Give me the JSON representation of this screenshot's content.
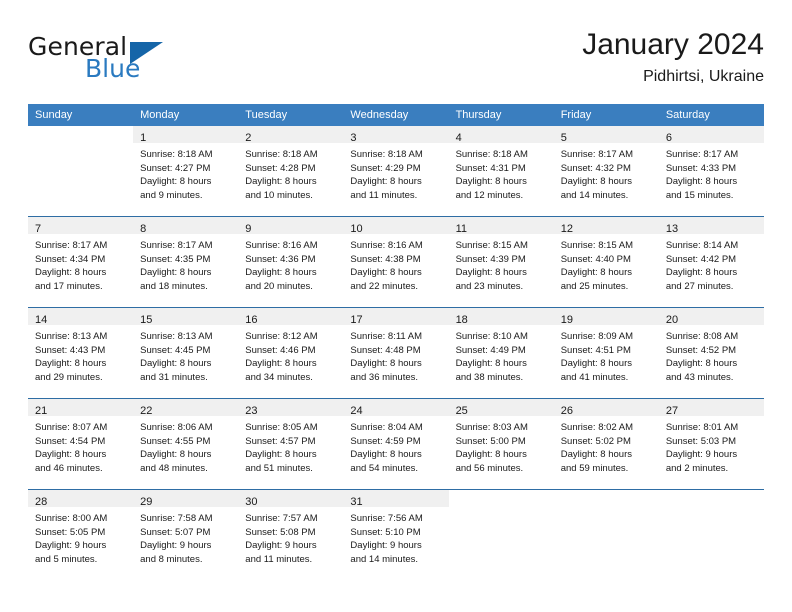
{
  "brand": {
    "word1": "General",
    "word2": "Blue",
    "accent_color": "#1565a8",
    "text_color": "#2a7ac0"
  },
  "header": {
    "title": "January 2024",
    "location": "Pidhirtsi, Ukraine"
  },
  "theme": {
    "header_bg": "#3a7ebf",
    "row_rule": "#2e6da4",
    "daynum_bg": "#f0f0f0"
  },
  "weekdays": [
    "Sunday",
    "Monday",
    "Tuesday",
    "Wednesday",
    "Thursday",
    "Friday",
    "Saturday"
  ],
  "weeks": [
    [
      {
        "day": "",
        "sunrise": "",
        "sunset": "",
        "daylight1": "",
        "daylight2": ""
      },
      {
        "day": "1",
        "sunrise": "Sunrise: 8:18 AM",
        "sunset": "Sunset: 4:27 PM",
        "daylight1": "Daylight: 8 hours",
        "daylight2": "and 9 minutes."
      },
      {
        "day": "2",
        "sunrise": "Sunrise: 8:18 AM",
        "sunset": "Sunset: 4:28 PM",
        "daylight1": "Daylight: 8 hours",
        "daylight2": "and 10 minutes."
      },
      {
        "day": "3",
        "sunrise": "Sunrise: 8:18 AM",
        "sunset": "Sunset: 4:29 PM",
        "daylight1": "Daylight: 8 hours",
        "daylight2": "and 11 minutes."
      },
      {
        "day": "4",
        "sunrise": "Sunrise: 8:18 AM",
        "sunset": "Sunset: 4:31 PM",
        "daylight1": "Daylight: 8 hours",
        "daylight2": "and 12 minutes."
      },
      {
        "day": "5",
        "sunrise": "Sunrise: 8:17 AM",
        "sunset": "Sunset: 4:32 PM",
        "daylight1": "Daylight: 8 hours",
        "daylight2": "and 14 minutes."
      },
      {
        "day": "6",
        "sunrise": "Sunrise: 8:17 AM",
        "sunset": "Sunset: 4:33 PM",
        "daylight1": "Daylight: 8 hours",
        "daylight2": "and 15 minutes."
      }
    ],
    [
      {
        "day": "7",
        "sunrise": "Sunrise: 8:17 AM",
        "sunset": "Sunset: 4:34 PM",
        "daylight1": "Daylight: 8 hours",
        "daylight2": "and 17 minutes."
      },
      {
        "day": "8",
        "sunrise": "Sunrise: 8:17 AM",
        "sunset": "Sunset: 4:35 PM",
        "daylight1": "Daylight: 8 hours",
        "daylight2": "and 18 minutes."
      },
      {
        "day": "9",
        "sunrise": "Sunrise: 8:16 AM",
        "sunset": "Sunset: 4:36 PM",
        "daylight1": "Daylight: 8 hours",
        "daylight2": "and 20 minutes."
      },
      {
        "day": "10",
        "sunrise": "Sunrise: 8:16 AM",
        "sunset": "Sunset: 4:38 PM",
        "daylight1": "Daylight: 8 hours",
        "daylight2": "and 22 minutes."
      },
      {
        "day": "11",
        "sunrise": "Sunrise: 8:15 AM",
        "sunset": "Sunset: 4:39 PM",
        "daylight1": "Daylight: 8 hours",
        "daylight2": "and 23 minutes."
      },
      {
        "day": "12",
        "sunrise": "Sunrise: 8:15 AM",
        "sunset": "Sunset: 4:40 PM",
        "daylight1": "Daylight: 8 hours",
        "daylight2": "and 25 minutes."
      },
      {
        "day": "13",
        "sunrise": "Sunrise: 8:14 AM",
        "sunset": "Sunset: 4:42 PM",
        "daylight1": "Daylight: 8 hours",
        "daylight2": "and 27 minutes."
      }
    ],
    [
      {
        "day": "14",
        "sunrise": "Sunrise: 8:13 AM",
        "sunset": "Sunset: 4:43 PM",
        "daylight1": "Daylight: 8 hours",
        "daylight2": "and 29 minutes."
      },
      {
        "day": "15",
        "sunrise": "Sunrise: 8:13 AM",
        "sunset": "Sunset: 4:45 PM",
        "daylight1": "Daylight: 8 hours",
        "daylight2": "and 31 minutes."
      },
      {
        "day": "16",
        "sunrise": "Sunrise: 8:12 AM",
        "sunset": "Sunset: 4:46 PM",
        "daylight1": "Daylight: 8 hours",
        "daylight2": "and 34 minutes."
      },
      {
        "day": "17",
        "sunrise": "Sunrise: 8:11 AM",
        "sunset": "Sunset: 4:48 PM",
        "daylight1": "Daylight: 8 hours",
        "daylight2": "and 36 minutes."
      },
      {
        "day": "18",
        "sunrise": "Sunrise: 8:10 AM",
        "sunset": "Sunset: 4:49 PM",
        "daylight1": "Daylight: 8 hours",
        "daylight2": "and 38 minutes."
      },
      {
        "day": "19",
        "sunrise": "Sunrise: 8:09 AM",
        "sunset": "Sunset: 4:51 PM",
        "daylight1": "Daylight: 8 hours",
        "daylight2": "and 41 minutes."
      },
      {
        "day": "20",
        "sunrise": "Sunrise: 8:08 AM",
        "sunset": "Sunset: 4:52 PM",
        "daylight1": "Daylight: 8 hours",
        "daylight2": "and 43 minutes."
      }
    ],
    [
      {
        "day": "21",
        "sunrise": "Sunrise: 8:07 AM",
        "sunset": "Sunset: 4:54 PM",
        "daylight1": "Daylight: 8 hours",
        "daylight2": "and 46 minutes."
      },
      {
        "day": "22",
        "sunrise": "Sunrise: 8:06 AM",
        "sunset": "Sunset: 4:55 PM",
        "daylight1": "Daylight: 8 hours",
        "daylight2": "and 48 minutes."
      },
      {
        "day": "23",
        "sunrise": "Sunrise: 8:05 AM",
        "sunset": "Sunset: 4:57 PM",
        "daylight1": "Daylight: 8 hours",
        "daylight2": "and 51 minutes."
      },
      {
        "day": "24",
        "sunrise": "Sunrise: 8:04 AM",
        "sunset": "Sunset: 4:59 PM",
        "daylight1": "Daylight: 8 hours",
        "daylight2": "and 54 minutes."
      },
      {
        "day": "25",
        "sunrise": "Sunrise: 8:03 AM",
        "sunset": "Sunset: 5:00 PM",
        "daylight1": "Daylight: 8 hours",
        "daylight2": "and 56 minutes."
      },
      {
        "day": "26",
        "sunrise": "Sunrise: 8:02 AM",
        "sunset": "Sunset: 5:02 PM",
        "daylight1": "Daylight: 8 hours",
        "daylight2": "and 59 minutes."
      },
      {
        "day": "27",
        "sunrise": "Sunrise: 8:01 AM",
        "sunset": "Sunset: 5:03 PM",
        "daylight1": "Daylight: 9 hours",
        "daylight2": "and 2 minutes."
      }
    ],
    [
      {
        "day": "28",
        "sunrise": "Sunrise: 8:00 AM",
        "sunset": "Sunset: 5:05 PM",
        "daylight1": "Daylight: 9 hours",
        "daylight2": "and 5 minutes."
      },
      {
        "day": "29",
        "sunrise": "Sunrise: 7:58 AM",
        "sunset": "Sunset: 5:07 PM",
        "daylight1": "Daylight: 9 hours",
        "daylight2": "and 8 minutes."
      },
      {
        "day": "30",
        "sunrise": "Sunrise: 7:57 AM",
        "sunset": "Sunset: 5:08 PM",
        "daylight1": "Daylight: 9 hours",
        "daylight2": "and 11 minutes."
      },
      {
        "day": "31",
        "sunrise": "Sunrise: 7:56 AM",
        "sunset": "Sunset: 5:10 PM",
        "daylight1": "Daylight: 9 hours",
        "daylight2": "and 14 minutes."
      },
      {
        "day": "",
        "sunrise": "",
        "sunset": "",
        "daylight1": "",
        "daylight2": ""
      },
      {
        "day": "",
        "sunrise": "",
        "sunset": "",
        "daylight1": "",
        "daylight2": ""
      },
      {
        "day": "",
        "sunrise": "",
        "sunset": "",
        "daylight1": "",
        "daylight2": ""
      }
    ]
  ]
}
